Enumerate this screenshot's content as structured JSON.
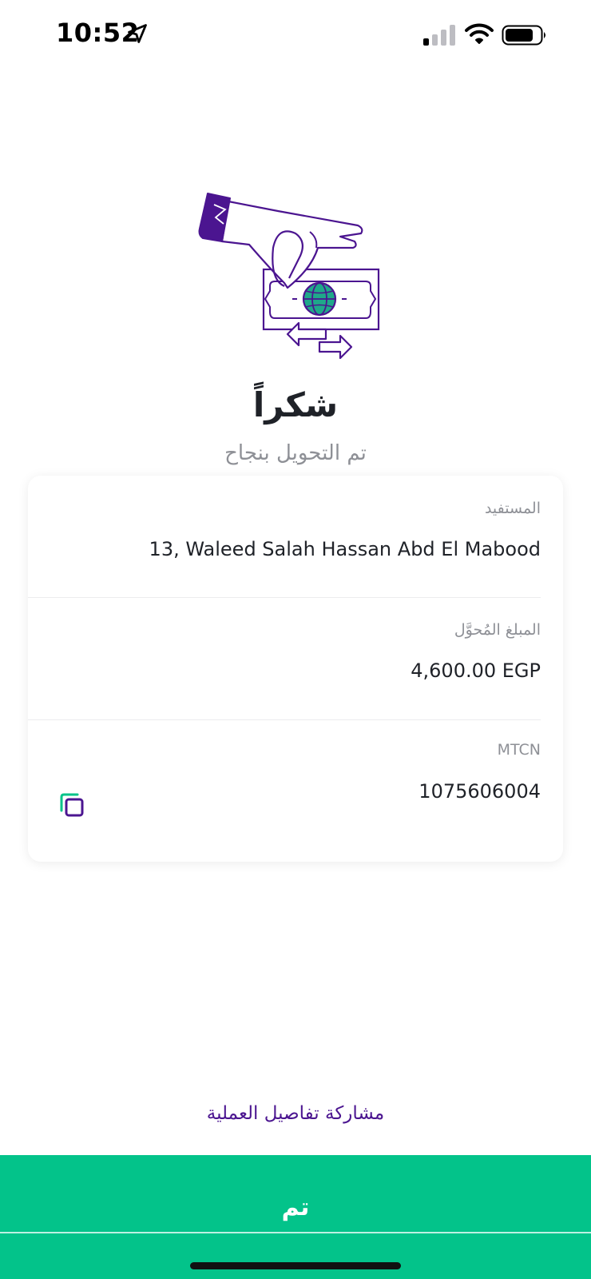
{
  "status_bar": {
    "time": "10:52"
  },
  "success": {
    "title": "شكراً",
    "subtitle": "تم التحويل بنجاح"
  },
  "details": {
    "beneficiary_label": "المستفيد",
    "beneficiary_value": "13, Waleed Salah Hassan Abd El Mabood",
    "amount_label": "المبلغ المُحوَّل",
    "amount_value": "4,600.00 EGP",
    "mtcn_label": "MTCN",
    "mtcn_value": "1075606004"
  },
  "actions": {
    "share_label": "مشاركة تفاصيل العملية",
    "done_label": "تم"
  },
  "colors": {
    "brand_purple": "#4b1590",
    "accent_green": "#03c38a",
    "globe_teal": "#1fa88a",
    "muted_text": "#8e9096"
  },
  "icons": {
    "location": "location-arrow-icon",
    "signal": "cellular-signal-icon",
    "wifi": "wifi-icon",
    "battery": "battery-icon",
    "copy": "copy-icon",
    "illustration": "money-transfer-illustration"
  }
}
